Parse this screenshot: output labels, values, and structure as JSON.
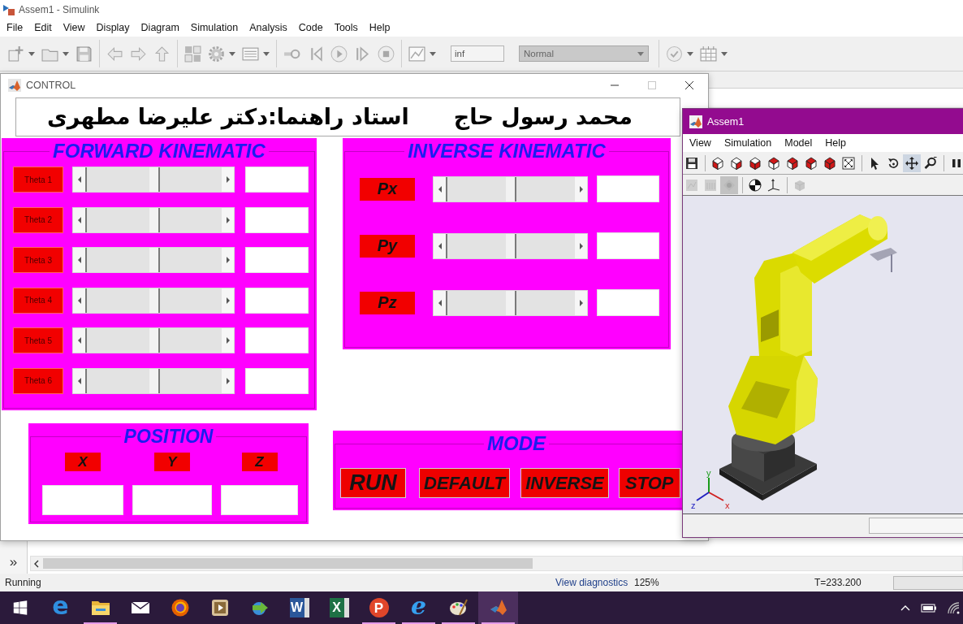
{
  "simulink": {
    "title": "Assem1 - Simulink",
    "menu": [
      "File",
      "Edit",
      "View",
      "Display",
      "Diagram",
      "Simulation",
      "Analysis",
      "Code",
      "Tools",
      "Help"
    ],
    "toolbar": [
      {
        "kind": "new",
        "caret": true
      },
      {
        "kind": "open",
        "caret": true
      },
      {
        "kind": "save",
        "caret": false
      },
      {
        "kind": "separator"
      },
      {
        "kind": "back",
        "caret": false
      },
      {
        "kind": "forward",
        "caret": false
      },
      {
        "kind": "up",
        "caret": false
      },
      {
        "kind": "separator"
      },
      {
        "kind": "library",
        "caret": false
      },
      {
        "kind": "settings",
        "caret": true
      },
      {
        "kind": "explorer",
        "caret": true
      },
      {
        "kind": "separator"
      },
      {
        "kind": "record",
        "caret": false
      },
      {
        "kind": "step-back",
        "caret": false
      },
      {
        "kind": "run",
        "caret": false
      },
      {
        "kind": "step-forward",
        "caret": false
      },
      {
        "kind": "stop",
        "caret": false
      },
      {
        "kind": "separator"
      },
      {
        "kind": "scope",
        "caret": true
      },
      {
        "kind": "stop-time",
        "value": "inf"
      },
      {
        "kind": "mode",
        "value": "Normal"
      },
      {
        "kind": "separator"
      },
      {
        "kind": "check",
        "caret": true
      },
      {
        "kind": "grid",
        "caret": true
      }
    ],
    "palette_toggle": "»",
    "status_bar": {
      "state": "Running",
      "diagnostics": "View diagnostics",
      "zoom": "125%",
      "time": "T=233.200"
    }
  },
  "control": {
    "title": "CONTROL",
    "header": {
      "supervisor": "استاد راهنما:دکتر علیرضا مطهری",
      "student": "محمد رسول حاج"
    },
    "forward": {
      "title": "FORWARD KINEMATIC",
      "rows": [
        {
          "label": "Theta 1",
          "level": 0.5
        },
        {
          "label": "Theta 2",
          "level": 0.5
        },
        {
          "label": "Theta 3",
          "level": 0.5
        },
        {
          "label": "Theta 4",
          "level": 0.5
        },
        {
          "label": "Theta 5",
          "level": 0.5
        },
        {
          "label": "Theta 6",
          "level": 0.5
        }
      ]
    },
    "inverse": {
      "title": "INVERSE KINEMATIC",
      "rows": [
        {
          "label": "Px",
          "level": 0.5
        },
        {
          "label": "Py",
          "level": 0.5
        },
        {
          "label": "Pz",
          "level": 0.5
        }
      ]
    },
    "position": {
      "title": "POSITION",
      "labels": [
        "X",
        "Y",
        "Z"
      ]
    },
    "mode": {
      "title": "MODE",
      "buttons": [
        "RUN",
        "DEFAULT",
        "INVERSE",
        "STOP"
      ]
    }
  },
  "viewer": {
    "title": "Assem1",
    "menu": [
      "View",
      "Simulation",
      "Model",
      "Help"
    ],
    "toolbar": [
      {
        "kind": "save",
        "selected": false
      },
      {
        "kind": "separator"
      },
      {
        "kind": "view-front",
        "selected": false
      },
      {
        "kind": "view-back",
        "selected": false
      },
      {
        "kind": "view-left",
        "selected": false
      },
      {
        "kind": "view-right",
        "selected": false
      },
      {
        "kind": "view-top",
        "selected": false
      },
      {
        "kind": "view-bottom",
        "selected": false
      },
      {
        "kind": "view-iso",
        "selected": false
      },
      {
        "kind": "fit",
        "selected": false
      },
      {
        "kind": "separator"
      },
      {
        "kind": "pointer",
        "selected": false
      },
      {
        "kind": "rotate",
        "selected": false
      },
      {
        "kind": "pan",
        "selected": true
      },
      {
        "kind": "zoom",
        "selected": false
      },
      {
        "kind": "separator"
      },
      {
        "kind": "pause",
        "selected": false
      }
    ],
    "toolbar_2": [
      {
        "kind": "plot",
        "disabled": true,
        "selected": false
      },
      {
        "kind": "bars",
        "disabled": true,
        "selected": false
      },
      {
        "kind": "diamond",
        "disabled": true,
        "selected": true
      },
      {
        "kind": "separator"
      },
      {
        "kind": "center-of-mass",
        "disabled": false,
        "selected": false
      },
      {
        "kind": "axes",
        "disabled": false,
        "selected": false
      },
      {
        "kind": "separator"
      },
      {
        "kind": "layers",
        "disabled": true,
        "selected": false
      }
    ],
    "triad_labels": [
      "y",
      "z",
      "x"
    ]
  },
  "taskbar": {
    "apps": [
      {
        "kind": "e-blue",
        "letter": "e",
        "running": false,
        "selected": false
      },
      {
        "kind": "folder",
        "running": true,
        "selected": false
      },
      {
        "kind": "mail",
        "running": false,
        "selected": false
      },
      {
        "kind": "fire-globe",
        "running": false,
        "selected": false
      },
      {
        "kind": "media",
        "running": false,
        "selected": false
      },
      {
        "kind": "globe-arrow",
        "running": false,
        "selected": false
      },
      {
        "kind": "doc-tile",
        "letter": "W",
        "running": false,
        "selected": false
      },
      {
        "kind": "sheet-tile",
        "letter": "X",
        "running": false,
        "selected": false
      },
      {
        "kind": "p-circle",
        "letter": "P",
        "running": true,
        "selected": false
      },
      {
        "kind": "e-ring",
        "letter": "e",
        "running": true,
        "selected": false
      },
      {
        "kind": "palette",
        "running": true,
        "selected": false
      },
      {
        "kind": "membrane",
        "running": true,
        "selected": true
      }
    ]
  }
}
